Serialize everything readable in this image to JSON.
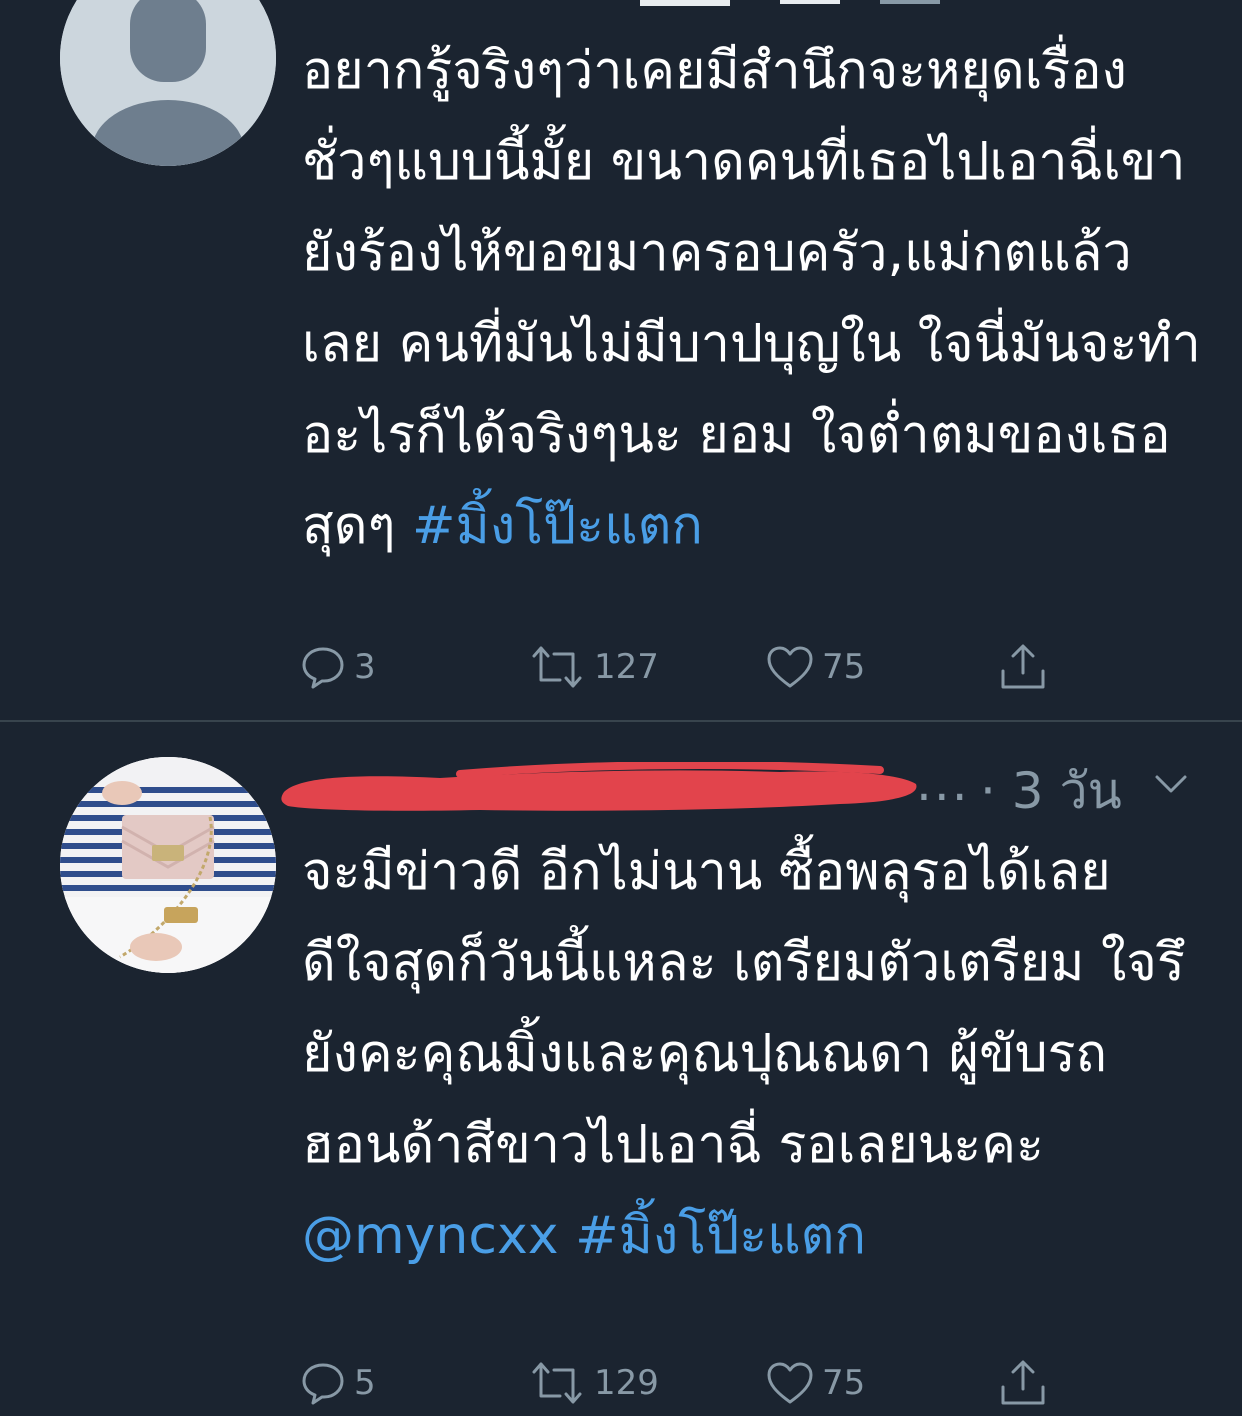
{
  "tweets": [
    {
      "text": "อยากรู้จริงๆว่าเคยมีสำนึกจะหยุดเรื่องชั่วๆแบบนี้มั้ย ขนาดคนที่เธอไปเอาฉี่เขายังร้องไห้ขอขมาครอบครัว,แม่กตแล้วเลย คนที่มันไม่มีบาปบุญใน ใจนี่มันจะทำอะไรก็ได้จริงๆนะ ยอม ใจต่ำตมของเธอสุดๆ ",
      "hashtag": "#มิ้งโป๊ะแตก",
      "counts": {
        "replies": "3",
        "retweets": "127",
        "likes": "75"
      }
    },
    {
      "handle_tail": "...",
      "time": "· 3 วัน",
      "text": "จะมีข่าวดี อีกไม่นาน ซื้อพลุรอได้เลย ดีใจสุดก็วันนี้แหละ เตรียมตัวเตรียม ใจรึยังคะคุณมิ้งและคุณปุณณดา ผู้ขับรถฮอนด้าสีขาวไปเอาฉี่ รอเลยนะคะ ",
      "mention": "@myncxx",
      "hashtag": "#มิ้งโป๊ะแตก",
      "counts": {
        "replies": "5",
        "retweets": "129",
        "likes": "75"
      }
    }
  ],
  "icons": {
    "reply": "reply-icon",
    "retweet": "retweet-icon",
    "like": "heart-icon",
    "share": "share-icon",
    "caret": "chevron-down-icon",
    "default_avatar": "default-avatar-icon"
  },
  "colors": {
    "background": "#1b2430",
    "text": "#ffffff",
    "secondary": "#8899a6",
    "link": "#4a9ee6",
    "divider": "#38444d",
    "redaction": "#e2444c"
  }
}
